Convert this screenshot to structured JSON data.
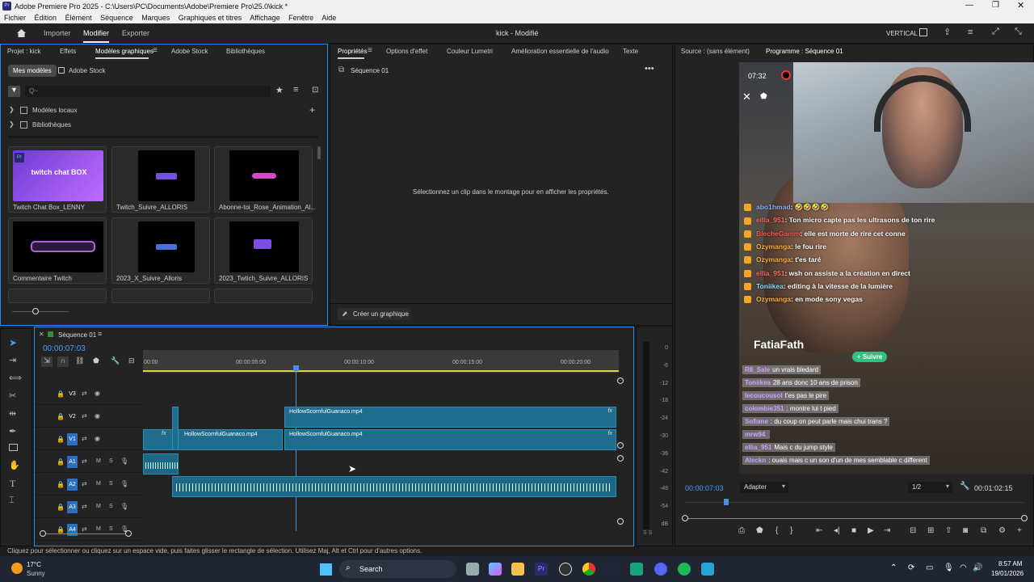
{
  "window": {
    "title": "Adobe Premiere Pro 2025 - C:\\Users\\PC\\Documents\\Adobe\\Premiere Pro\\25.0\\kick *",
    "app_icon": "Pr"
  },
  "menu": [
    "Fichier",
    "Édition",
    "Élément",
    "Séquence",
    "Marques",
    "Graphiques et titres",
    "Affichage",
    "Fenêtre",
    "Aide"
  ],
  "header": {
    "home": "home-icon",
    "tabs": [
      "Importer",
      "Modifier",
      "Exporter"
    ],
    "active_tab": "Modifier",
    "project_title": "kick - Modifié",
    "layout": "VERTICAL"
  },
  "left_panel": {
    "tabs": [
      "Projet : kick",
      "Effets",
      "Modèles graphiques",
      "Adobe Stock",
      "Bibliothèques"
    ],
    "active_tab": "Modèles graphiques",
    "subtabs": [
      "Mes modèles",
      "Adobe Stock"
    ],
    "search_placeholder": "Q~",
    "tree": [
      "Modèles locaux",
      "Bibliothèques"
    ],
    "templates": [
      {
        "name": "Twitch Chat Box_LENNY",
        "preview": "twitch chat BOX"
      },
      {
        "name": "Twitch_Suivre_ALLORIS"
      },
      {
        "name": "Abonne-toi_Rose_Animation_Al..."
      },
      {
        "name": "Commentaire Twitch"
      },
      {
        "name": "2023_X_Suivre_Alloris"
      },
      {
        "name": "2023_Twtich_Suivre_ALLORIS"
      }
    ]
  },
  "properties_panel": {
    "tabs": [
      "Propriétés",
      "Options d'effet",
      "Couleur Lumetri",
      "Amélioration essentielle de l'audio",
      "Texte"
    ],
    "active_tab": "Propriétés",
    "sequence": "Séquence 01",
    "message": "Sélectionnez un clip dans le montage pour en afficher les propriétés.",
    "create_button": "Créer un graphique"
  },
  "right_panel": {
    "source_tab": "Source : (sans élément)",
    "program_tab": "Programme : Séquence 01",
    "timecode": "00:00:07:03",
    "fit": "Adapter",
    "quality": "1/2",
    "duration": "00:01:02:15"
  },
  "preview": {
    "time": "07:32",
    "streamer": "FatiaFath",
    "follow_button": "+ Suivre",
    "chat": [
      {
        "user": "abo1hmad",
        "msg": ": 🤣🤣🤣🤣",
        "color": "#8fb4ff"
      },
      {
        "user": "ellia_951",
        "msg": ": Ton micro capte pas les ultrasons de ton rire",
        "color": "#ff6b6b"
      },
      {
        "user": "BlecheGamm",
        "msg": ": elle est morte de rire cet conne",
        "color": "#ff5a5a"
      },
      {
        "user": "Ozymanga",
        "msg": ": le fou rire",
        "color": "#ffb23c"
      },
      {
        "user": "Ozymanga",
        "msg": ": t'es taré",
        "color": "#ffb23c"
      },
      {
        "user": "ellia_951",
        "msg": ": wsh on assiste a la création en direct",
        "color": "#ff6b6b"
      },
      {
        "user": "Toniikea",
        "msg": ": editing à la vitesse de la lumière",
        "color": "#7ee0ff"
      },
      {
        "user": "Ozymanga",
        "msg": ": en mode sony vegas",
        "color": "#ffb23c"
      }
    ],
    "lower_chat": [
      {
        "user": "R8_Sale",
        "msg": "un vrais bledard"
      },
      {
        "user": "Toniikea",
        "msg": "28 ans donc 10 ans de prison"
      },
      {
        "user": "lecoucousol",
        "msg": "t'es pas le pire"
      },
      {
        "user": "colombie351",
        "msg": ": montre lui t pied"
      },
      {
        "user": "Sofiane",
        "msg": ": du coup on peut parle mais chui trans ?"
      },
      {
        "user": "mrw94",
        "msg": ""
      },
      {
        "user": "ellia_951",
        "msg": "Mais c du jump style"
      },
      {
        "user": "Aleckn",
        "msg": ": ouais mais c un son d'un de mes semblable c different"
      }
    ]
  },
  "timeline": {
    "sequence": "Séquence 01",
    "timecode": "00:00:07:03",
    "ruler": [
      "00:00",
      "00:00:05:00",
      "00:00:10:00",
      "00:00:15:00",
      "00:00:20:00"
    ],
    "tracks": [
      {
        "id": "V3"
      },
      {
        "id": "V2"
      },
      {
        "id": "V1"
      },
      {
        "id": "A1"
      },
      {
        "id": "A2"
      },
      {
        "id": "A3"
      },
      {
        "id": "A4"
      }
    ],
    "clips": [
      "HollowScornfulGuanaco.mp4",
      "HollowScornfulGuanaco.mp4",
      "HollowScornfulGuanaco.mp4"
    ],
    "fx": "fx",
    "mute": "M",
    "solo": "S"
  },
  "meter": {
    "ticks": [
      "0",
      "-6",
      "-12",
      "-18",
      "-24",
      "-30",
      "-36",
      "-42",
      "-48",
      "-54",
      "dB"
    ],
    "footer": "S S"
  },
  "statusbar": "Cliquez pour sélectionner ou cliquez sur un espace vide, puis faites glisser le rectangle de sélection. Utilisez Maj, Alt et Ctrl pour d'autres options.",
  "taskbar": {
    "temp": "17°C",
    "weather": "Sunny",
    "search": "Search",
    "time": "8:57 AM",
    "date": "19/01/2026"
  },
  "colors": {
    "accent": "#2d8ceb",
    "clip": "#1f6d8c",
    "playhead": "#4a90e2",
    "panel": "#232323"
  }
}
